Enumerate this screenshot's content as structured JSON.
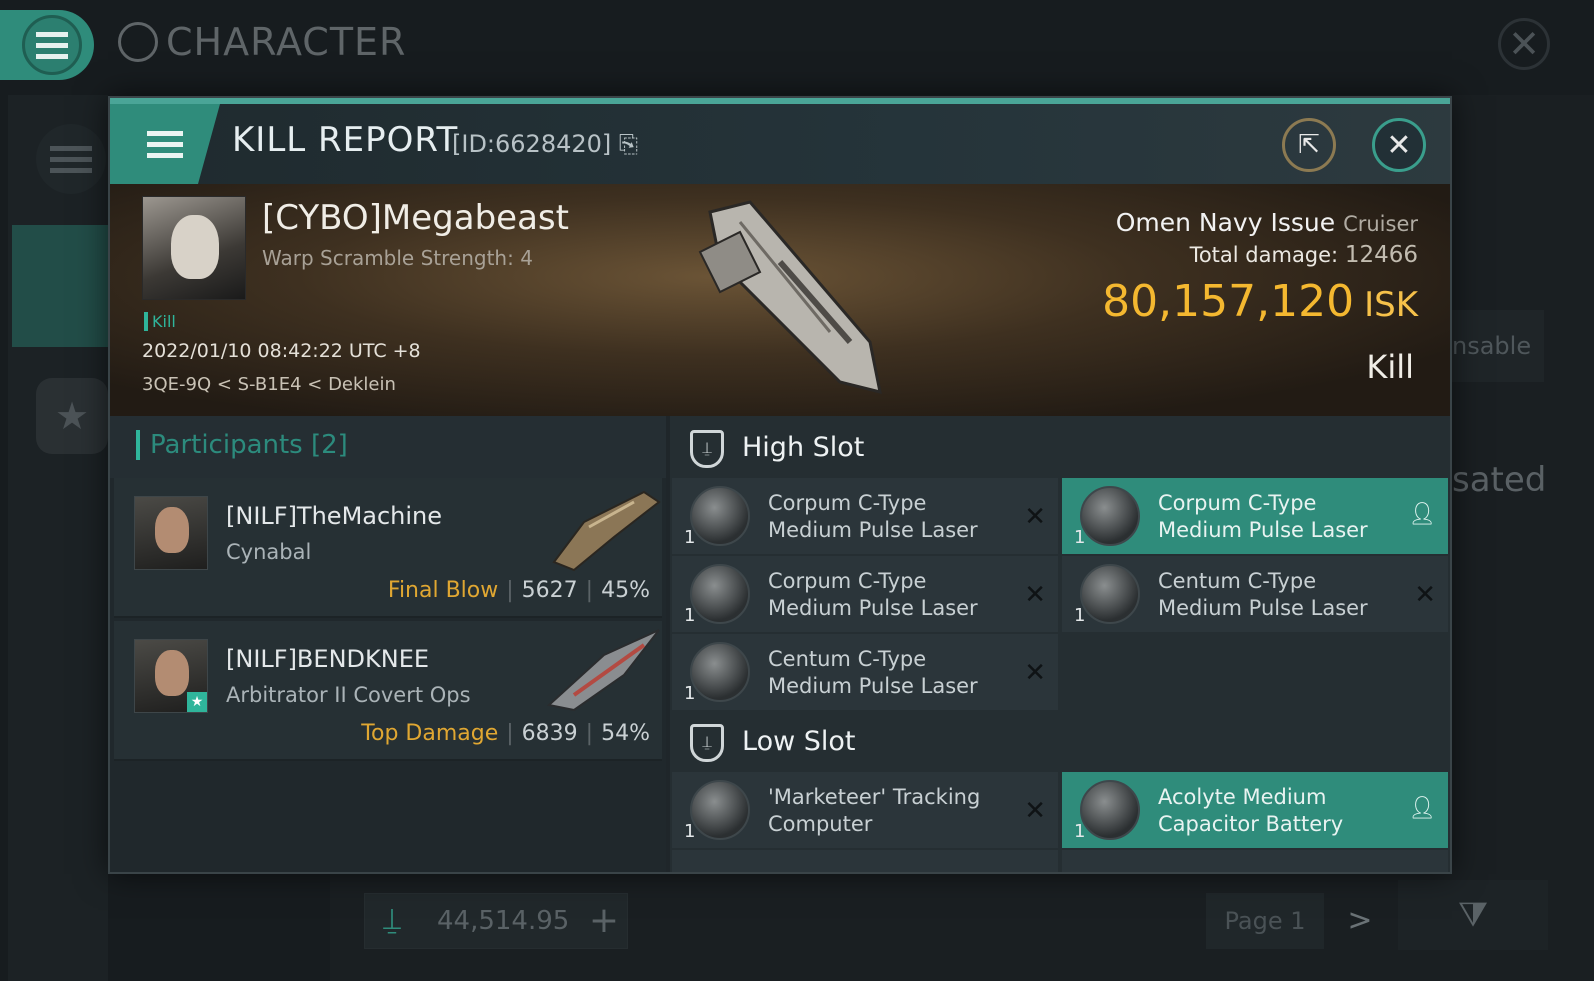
{
  "background": {
    "title": "CHARACTER",
    "side_text": "nsable",
    "side_text2": "sated",
    "wallet_value": "44,514.95",
    "page_label": "Page 1"
  },
  "modal": {
    "title": "KILL REPORT",
    "report_id": "[ID:6628420]"
  },
  "victim": {
    "name": "[CYBO]Megabeast",
    "warp_scramble": "Warp Scramble Strength: 4",
    "tag": "Kill",
    "timestamp": "2022/01/10 08:42:22 UTC +8",
    "location": "3QE-9Q < S-B1E4 < Deklein",
    "ship_name": "Omen Navy Issue",
    "ship_class": "Cruiser",
    "total_damage_label": "Total damage:",
    "total_damage": "12466",
    "isk_value": "80,157,120",
    "isk_unit": "ISK",
    "result": "Kill"
  },
  "participants": {
    "header": "Participants [2]",
    "list": [
      {
        "name": "[NILF]TheMachine",
        "ship": "Cynabal",
        "tag": "Final Blow",
        "damage": "5627",
        "percent": "45%"
      },
      {
        "name": "[NILF]BENDKNEE",
        "ship": "Arbitrator II Covert Ops",
        "tag": "Top Damage",
        "damage": "6839",
        "percent": "54%"
      }
    ]
  },
  "slots": {
    "high_label": "High Slot",
    "low_label": "Low Slot",
    "high": [
      {
        "qty": "1",
        "line1": "Corpum C-Type",
        "line2": "Medium Pulse Laser",
        "state": "destroyed"
      },
      {
        "qty": "1",
        "line1": "Corpum C-Type",
        "line2": "Medium Pulse Laser",
        "state": "dropped"
      },
      {
        "qty": "1",
        "line1": "Corpum C-Type",
        "line2": "Medium Pulse Laser",
        "state": "destroyed"
      },
      {
        "qty": "1",
        "line1": "Centum C-Type",
        "line2": "Medium Pulse Laser",
        "state": "destroyed"
      },
      {
        "qty": "1",
        "line1": "Centum C-Type",
        "line2": "Medium Pulse Laser",
        "state": "destroyed"
      }
    ],
    "low": [
      {
        "qty": "1",
        "line1": "'Marketeer' Tracking",
        "line2": "Computer",
        "state": "destroyed"
      },
      {
        "qty": "1",
        "line1": "Acolyte Medium",
        "line2": "Capacitor Battery",
        "state": "dropped"
      }
    ]
  },
  "icons": {
    "destroyed": "✕",
    "dropped": "person-icon"
  },
  "colors": {
    "accent": "#2f8c7b",
    "isk": "#f4b830",
    "final_blow": "#e0a732"
  }
}
